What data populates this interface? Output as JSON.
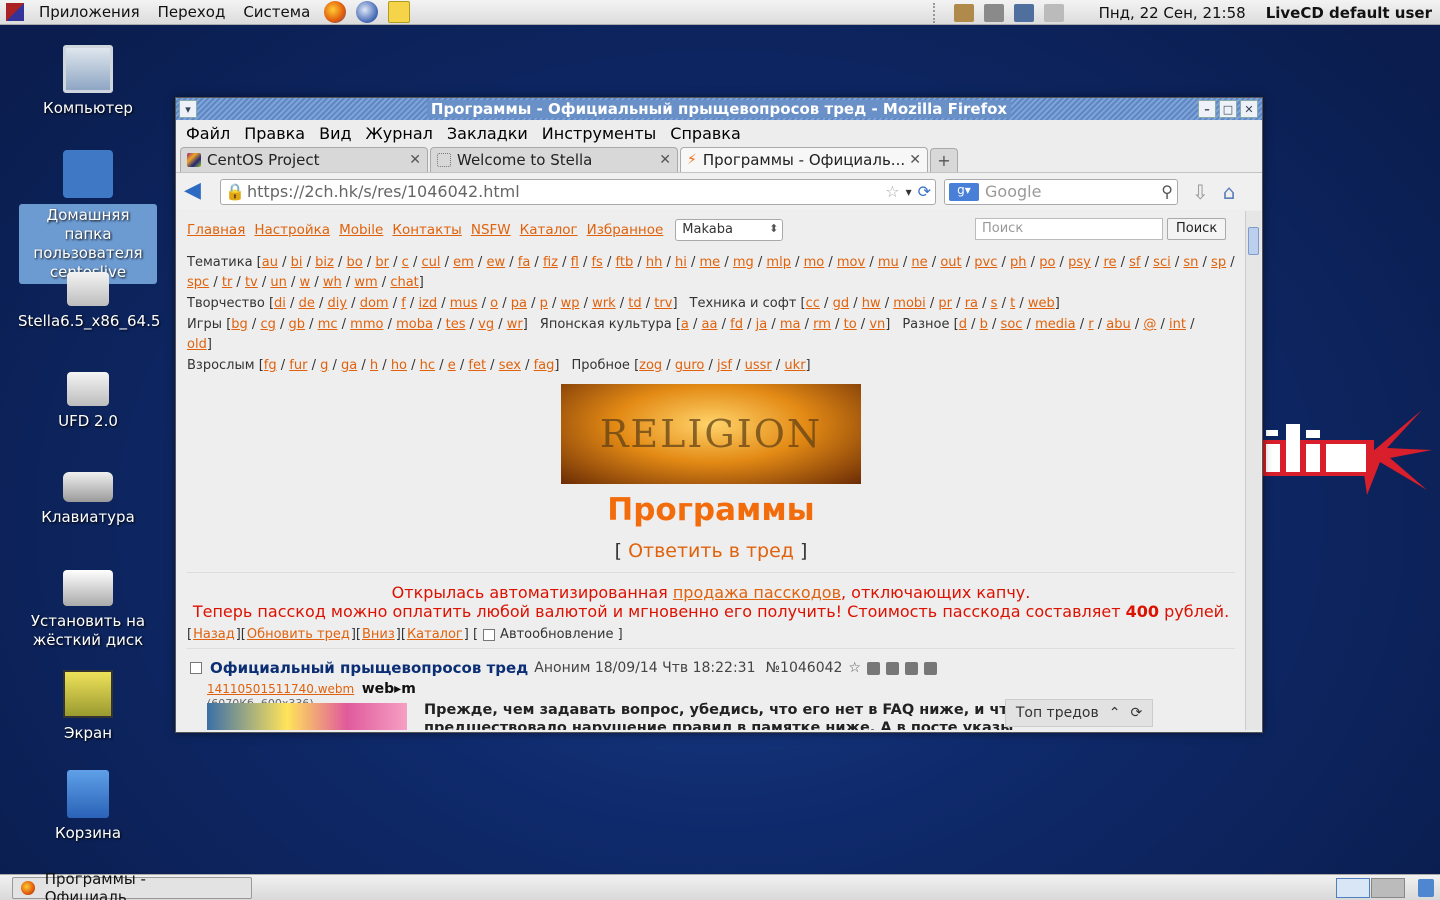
{
  "top_panel": {
    "menus": [
      "Приложения",
      "Переход",
      "Система"
    ],
    "clock": "Пнд, 22 Сен, 21:58",
    "user": "LiveCD default user"
  },
  "desktop_icons": [
    {
      "label": "Компьютер"
    },
    {
      "label": "Домашняя папка пользователя centoslive"
    },
    {
      "label": "Stella6.5_x86_64.5"
    },
    {
      "label": "UFD 2.0"
    },
    {
      "label": "Клавиатура"
    },
    {
      "label": "Установить на жёсткий диск"
    },
    {
      "label": "Экран"
    },
    {
      "label": "Корзина"
    }
  ],
  "window": {
    "title": "Программы - Официальный прыщевопросов тред - Mozilla Firefox"
  },
  "menubar": [
    "Файл",
    "Правка",
    "Вид",
    "Журнал",
    "Закладки",
    "Инструменты",
    "Справка"
  ],
  "tabs": [
    {
      "label": "CentOS Project"
    },
    {
      "label": "Welcome to Stella"
    },
    {
      "label": "Программы - Официаль..."
    }
  ],
  "navbar": {
    "url": "https://2ch.hk/s/res/1046042.html",
    "search_placeholder": "Google"
  },
  "page": {
    "topnav": [
      "Главная",
      "Настройка",
      "Mobile",
      "Контакты",
      "NSFW",
      "Каталог",
      "Избранное"
    ],
    "skin": "Makaba",
    "search_placeholder": "Поиск",
    "search_button": "Поиск",
    "groups": [
      {
        "name": "Тематика",
        "boards": [
          "au",
          "bi",
          "biz",
          "bo",
          "br",
          "c",
          "cul",
          "em",
          "ew",
          "fa",
          "fiz",
          "fl",
          "fs",
          "ftb",
          "hh",
          "hi",
          "me",
          "mg",
          "mlp",
          "mo",
          "mov",
          "mu",
          "ne",
          "out",
          "pvc",
          "ph",
          "po",
          "psy",
          "re",
          "sf",
          "sci",
          "sn",
          "sp",
          "spc",
          "tr",
          "tv",
          "un",
          "w",
          "wh",
          "wm",
          "chat"
        ]
      },
      {
        "name": "Творчество",
        "boards": [
          "di",
          "de",
          "diy",
          "dom",
          "f",
          "izd",
          "mus",
          "o",
          "pa",
          "p",
          "wp",
          "wrk",
          "td",
          "trv"
        ]
      },
      {
        "name": "Техника и софт",
        "boards": [
          "cc",
          "gd",
          "hw",
          "mobi",
          "pr",
          "ra",
          "s",
          "t",
          "web"
        ]
      },
      {
        "name": "Игры",
        "boards": [
          "bg",
          "cg",
          "gb",
          "mc",
          "mmo",
          "moba",
          "tes",
          "vg",
          "wr"
        ]
      },
      {
        "name": "Японская культура",
        "boards": [
          "a",
          "aa",
          "fd",
          "ja",
          "ma",
          "rm",
          "to",
          "vn"
        ]
      },
      {
        "name": "Разное",
        "boards": [
          "d",
          "b",
          "soc",
          "media",
          "r",
          "abu",
          "@",
          "int",
          "old"
        ]
      },
      {
        "name": "Взрослым",
        "boards": [
          "fg",
          "fur",
          "g",
          "ga",
          "h",
          "ho",
          "hc",
          "e",
          "fet",
          "sex",
          "fag"
        ]
      },
      {
        "name": "Пробное",
        "boards": [
          "zog",
          "guro",
          "jsf",
          "ussr",
          "ukr"
        ]
      }
    ],
    "banner_text": "RELIGION",
    "board_title": "Программы",
    "reply_link": "Ответить в тред",
    "notice": {
      "line1_a": "Открылась автоматизированная ",
      "line1_link": "продажа пасскодов",
      "line1_b": ", отключающих капчу.",
      "line2_a": "Теперь пасскод можно оплатить любой валютой и мгновенно его получить! Стоимость пасскода составляет ",
      "line2_bold": "400",
      "line2_b": " рублей."
    },
    "thread_nav": {
      "back": "Назад",
      "refresh": "Обновить тред",
      "down": "Вниз",
      "catalog": "Каталог",
      "auto": "Автообновление"
    },
    "post": {
      "subject": "Официальный прыщевопросов тред",
      "meta": "Аноним 18/09/14 Чтв 18:22:31",
      "num": "№1046042",
      "file": "14110501511740.webm",
      "file_info": "(6070Кб, 600x336)",
      "webm": "web▸m",
      "text": "Прежде, чем задавать вопрос, убедись, что его нет в FAQ ниже, и что ничего не предшествовало нарушение правил в памятке ниже. А в посте указы"
    },
    "top_threads": "Топ тредов"
  },
  "taskbar": {
    "item": "Программы - Официаль..."
  }
}
